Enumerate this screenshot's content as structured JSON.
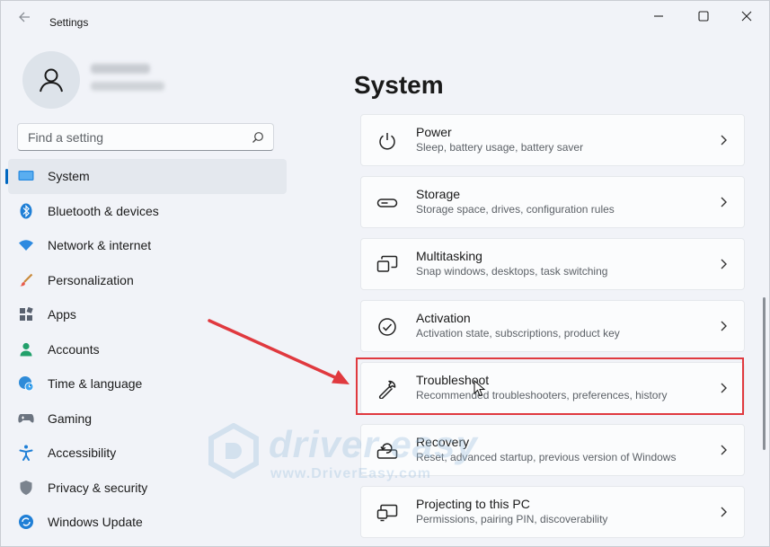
{
  "window": {
    "title": "Settings"
  },
  "search": {
    "placeholder": "Find a setting"
  },
  "nav": {
    "items": [
      {
        "label": "System",
        "icon": "monitor-icon",
        "active": true
      },
      {
        "label": "Bluetooth & devices",
        "icon": "bluetooth-icon"
      },
      {
        "label": "Network & internet",
        "icon": "wifi-icon"
      },
      {
        "label": "Personalization",
        "icon": "brush-icon"
      },
      {
        "label": "Apps",
        "icon": "apps-icon"
      },
      {
        "label": "Accounts",
        "icon": "person-icon"
      },
      {
        "label": "Time & language",
        "icon": "globe-clock-icon"
      },
      {
        "label": "Gaming",
        "icon": "gamepad-icon"
      },
      {
        "label": "Accessibility",
        "icon": "accessibility-icon"
      },
      {
        "label": "Privacy & security",
        "icon": "shield-icon"
      },
      {
        "label": "Windows Update",
        "icon": "update-icon"
      }
    ]
  },
  "main": {
    "title": "System",
    "cards": [
      {
        "title": "Power",
        "subtitle": "Sleep, battery usage, battery saver",
        "icon": "power-icon"
      },
      {
        "title": "Storage",
        "subtitle": "Storage space, drives, configuration rules",
        "icon": "storage-icon"
      },
      {
        "title": "Multitasking",
        "subtitle": "Snap windows, desktops, task switching",
        "icon": "multitasking-icon"
      },
      {
        "title": "Activation",
        "subtitle": "Activation state, subscriptions, product key",
        "icon": "check-circle-icon"
      },
      {
        "title": "Troubleshoot",
        "subtitle": "Recommended troubleshooters, preferences, history",
        "icon": "wrench-icon",
        "highlighted": true
      },
      {
        "title": "Recovery",
        "subtitle": "Reset, advanced startup, previous version of Windows",
        "icon": "recovery-icon"
      },
      {
        "title": "Projecting to this PC",
        "subtitle": "Permissions, pairing PIN, discoverability",
        "icon": "projector-icon"
      }
    ]
  },
  "watermark": {
    "brand": "driver easy",
    "url": "www.DriverEasy.com"
  },
  "colors": {
    "accent": "#0067c0",
    "annotation": "#e0393f"
  }
}
